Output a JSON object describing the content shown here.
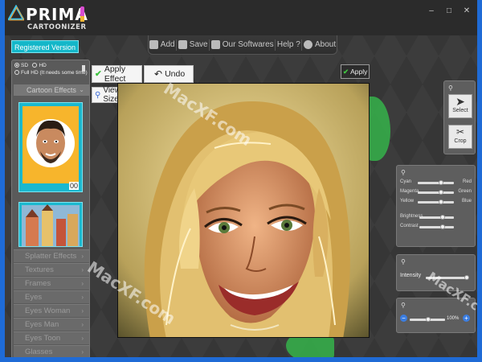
{
  "app": {
    "logo_main": "PRIMA",
    "logo_sub": "CARTOONIZER",
    "window_controls": [
      "–",
      "□",
      "✕"
    ]
  },
  "registered": "Registered Version",
  "toolbar": {
    "add": "Add",
    "save": "Save",
    "our_softwares": "Our Softwares",
    "help": "Help ?",
    "about": "About"
  },
  "left_panel": {
    "mode_sd": "SD",
    "mode_hd": "HD",
    "mode_fullhd": "Full HD (It needs some time)",
    "cartoon_effects": "Cartoon Effects",
    "thumb1_badge": "00",
    "menu": [
      "Splatter Effects",
      "Textures",
      "Frames",
      "Eyes",
      "Eyes Woman",
      "Eyes Man",
      "Eyes Toon",
      "Glasses"
    ]
  },
  "canvas": {
    "apply_effect": "Apply Effect",
    "undo": "Undo",
    "view_full_size": "View Full Size",
    "apply": "Apply"
  },
  "right_panel": {
    "select": "Select",
    "crop": "Crop",
    "color_sliders": [
      {
        "left": "Cyan",
        "right": "Red",
        "value": 0.5
      },
      {
        "left": "Magenta",
        "right": "Green",
        "value": 0.5
      },
      {
        "left": "Yellow",
        "right": "Blue",
        "value": 0.5
      }
    ],
    "tone_sliders": [
      {
        "left": "Brightness",
        "value": 0.5
      },
      {
        "left": "Contrast",
        "value": 0.5
      }
    ],
    "intensity_label": "Intensity",
    "intensity_value": 0.95,
    "zoom_label": "100%",
    "zoom_value": 0.5
  },
  "watermarks": [
    "MacXF.com",
    "MacXF.com",
    "MacXF.com"
  ]
}
